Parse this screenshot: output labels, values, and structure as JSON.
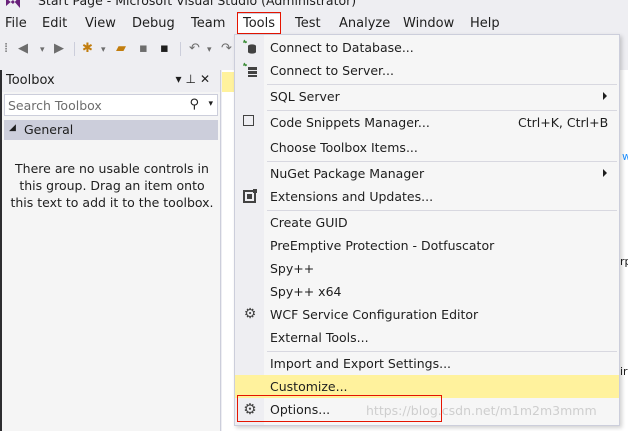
{
  "window": {
    "title": "Start Page - Microsoft Visual Studio (Administrator)"
  },
  "menubar": {
    "items": [
      "File",
      "Edit",
      "View",
      "Debug",
      "Team",
      "Tools",
      "Test",
      "Analyze",
      "Window",
      "Help"
    ],
    "active": "Tools"
  },
  "toolbox": {
    "title": "Toolbox",
    "search_placeholder": "Search Toolbox",
    "group": "General",
    "empty_message": "There are no usable controls in this group. Drag an item onto this text to add it to the toolbox."
  },
  "tools_menu": {
    "items": [
      {
        "label": "Connect to Database...",
        "icon": "connect-database-icon"
      },
      {
        "label": "Connect to Server...",
        "icon": "connect-server-icon"
      },
      {
        "label": "SQL Server",
        "submenu": true
      },
      {
        "label": "Code Snippets Manager...",
        "shortcut": "Ctrl+K, Ctrl+B",
        "icon": "snippets-checkbox-icon"
      },
      {
        "label": "Choose Toolbox Items..."
      },
      {
        "label": "NuGet Package Manager",
        "submenu": true
      },
      {
        "label": "Extensions and Updates...",
        "icon": "extensions-icon"
      },
      {
        "label": "Create GUID"
      },
      {
        "label": "PreEmptive Protection - Dotfuscator"
      },
      {
        "label": "Spy++"
      },
      {
        "label": "Spy++ x64"
      },
      {
        "label": "WCF Service Configuration Editor",
        "icon": "wcf-gear-icon"
      },
      {
        "label": "External Tools..."
      },
      {
        "label": "Import and Export Settings..."
      },
      {
        "label": "Customize...",
        "highlighted": true
      },
      {
        "label": "Options...",
        "icon": "options-gear-icon"
      }
    ]
  },
  "background_fragments": [
    "w",
    "rp",
    "ir"
  ],
  "watermark": "https://blog.csdn.net/m1m2m3mmm",
  "colors": {
    "highlight": "#fff29d",
    "annotation_red": "#e51400",
    "menu_bg": "#f6f6f6"
  }
}
